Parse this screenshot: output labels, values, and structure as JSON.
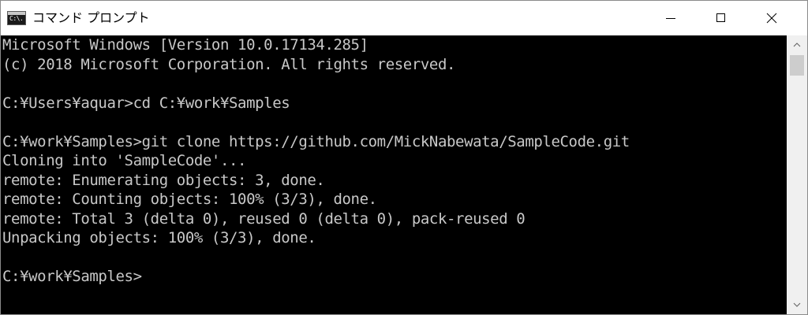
{
  "window": {
    "title": "コマンド プロンプト",
    "icon_text": "C:\\."
  },
  "controls": {
    "minimize": "minimize-icon",
    "maximize": "maximize-icon",
    "close": "close-icon"
  },
  "console": {
    "lines": [
      "Microsoft Windows [Version 10.0.17134.285]",
      "(c) 2018 Microsoft Corporation. All rights reserved.",
      "",
      "C:¥Users¥aquar>cd C:¥work¥Samples",
      "",
      "C:¥work¥Samples>git clone https://github.com/MickNabewata/SampleCode.git",
      "Cloning into 'SampleCode'...",
      "remote: Enumerating objects: 3, done.",
      "remote: Counting objects: 100% (3/3), done.",
      "remote: Total 3 (delta 0), reused 0 (delta 0), pack-reused 0",
      "Unpacking objects: 100% (3/3), done.",
      "",
      "C:¥work¥Samples>"
    ]
  },
  "colors": {
    "console_bg": "#000000",
    "console_text": "#c8c8c8",
    "titlebar_bg": "#ffffff"
  }
}
